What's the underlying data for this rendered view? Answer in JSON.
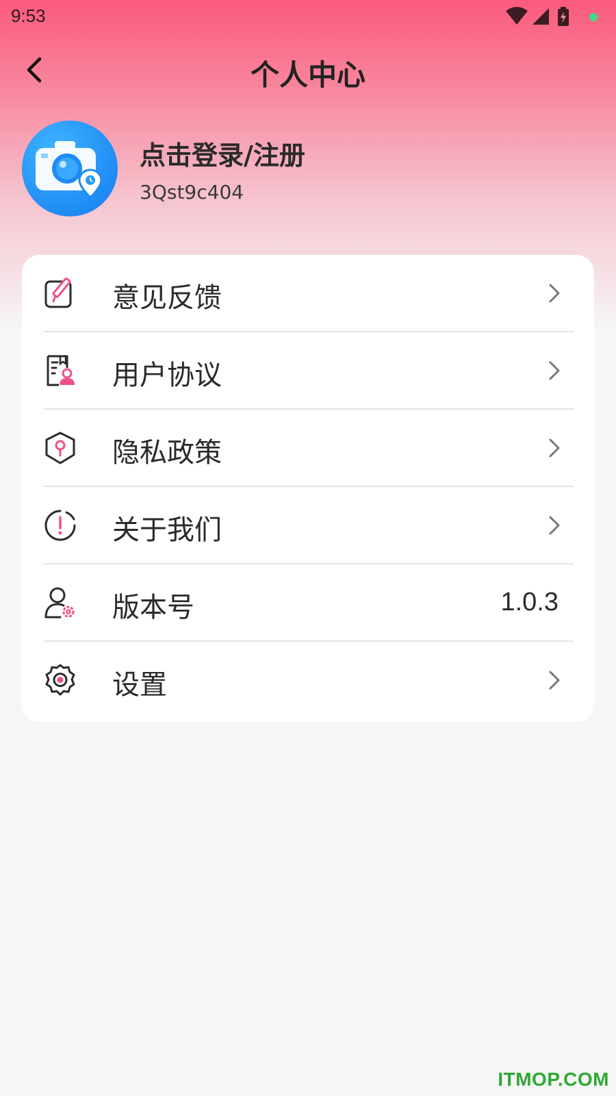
{
  "status_bar": {
    "time": "9:53",
    "icons": [
      "wifi-icon",
      "cellular-signal-icon",
      "battery-charging-icon",
      "notification-dot-icon"
    ]
  },
  "header": {
    "title": "个人中心",
    "back_icon": "chevron-left-icon"
  },
  "profile": {
    "avatar_icon": "camera-location-icon",
    "login_text": "点击登录/注册",
    "user_id": "3Qst9c404"
  },
  "menu": {
    "items": [
      {
        "label": "意见反馈",
        "icon": "edit-feedback-icon",
        "has_chevron": true
      },
      {
        "label": "用户协议",
        "icon": "user-agreement-icon",
        "has_chevron": true
      },
      {
        "label": "隐私政策",
        "icon": "privacy-shield-icon",
        "has_chevron": true
      },
      {
        "label": "关于我们",
        "icon": "info-exclamation-icon",
        "has_chevron": true
      },
      {
        "label": "版本号",
        "icon": "user-settings-icon",
        "value": "1.0.3",
        "has_chevron": false
      },
      {
        "label": "设置",
        "icon": "gear-icon",
        "has_chevron": true
      }
    ]
  },
  "colors": {
    "accent_pink": "#f0508c",
    "header_gradient_top": "#fb5a7c",
    "avatar_blue": "#1f8cf5",
    "watermark_green": "#2ea836"
  },
  "watermark": "ITMOP.COM"
}
